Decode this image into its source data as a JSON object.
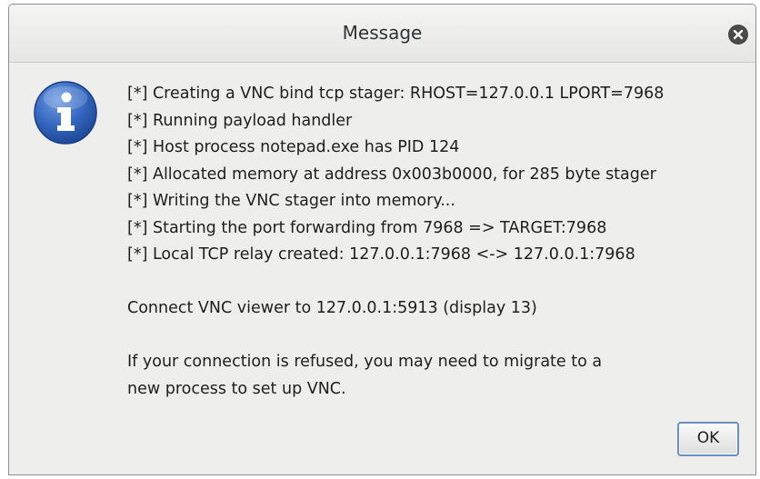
{
  "dialog": {
    "title": "Message",
    "icon": "info-icon",
    "log_lines": [
      "[*] Creating a VNC bind tcp stager: RHOST=127.0.0.1 LPORT=7968",
      "[*] Running payload handler",
      "[*] Host process notepad.exe has PID 124",
      "[*] Allocated memory at address 0x003b0000, for 285 byte stager",
      "[*] Writing the VNC stager into memory...",
      "[*] Starting the port forwarding from 7968 => TARGET:7968",
      "[*] Local TCP relay created: 127.0.0.1:7968 <-> 127.0.0.1:7968"
    ],
    "connect_line": "Connect VNC viewer to 127.0.0.1:5913 (display 13)",
    "refused_line_1": "If your connection is refused, you may need to migrate to a",
    "refused_line_2": "new process to set up VNC.",
    "ok_label": "OK"
  },
  "colors": {
    "icon_blue": "#2a5db0",
    "ok_border": "#6a8ec0",
    "background": "#eeeeec"
  }
}
